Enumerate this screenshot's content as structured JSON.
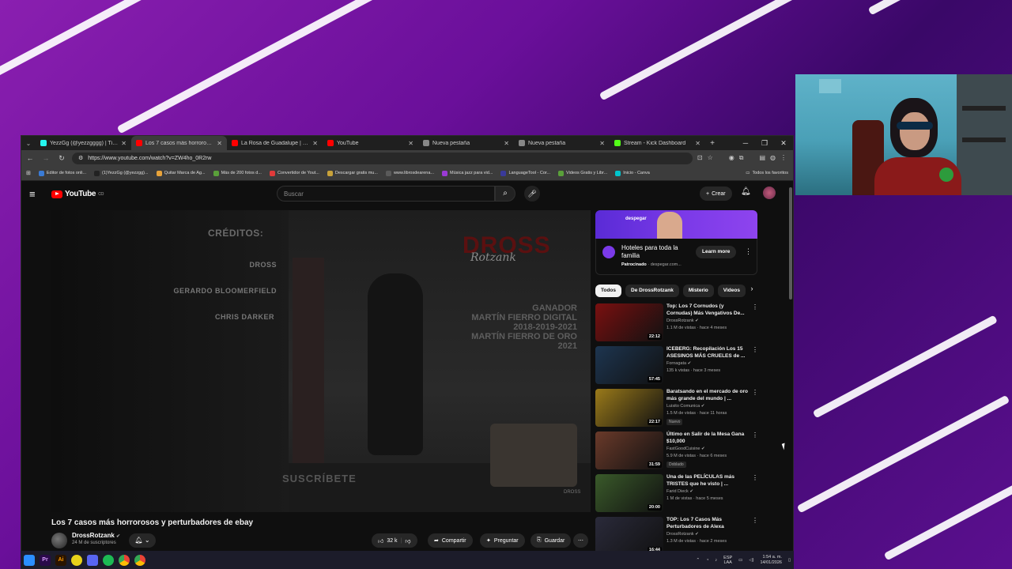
{
  "browser": {
    "tabs": [
      {
        "title": "YezzGg (@yezzgggg) | TikTok",
        "favicon_color": "#25f4ee"
      },
      {
        "title": "Los 7 casos más horrorosos y p",
        "favicon_color": "#ff0000"
      },
      {
        "title": "La Rosa de Guadalupe | El Nov",
        "favicon_color": "#ff0000"
      },
      {
        "title": "YouTube",
        "favicon_color": "#ff0000"
      },
      {
        "title": "Nueva pestaña",
        "favicon_color": "#888888"
      },
      {
        "title": "Nueva pestaña",
        "favicon_color": "#888888"
      },
      {
        "title": "Stream - Kick Dashboard",
        "favicon_color": "#53fc18"
      }
    ],
    "url": "https://www.youtube.com/watch?v=ZW4ho_0R2rw",
    "bookmarks": [
      "Editor de fotos onli...",
      "(1)YezzGg (@yezzgg)...",
      "Quitar Marca de Ag...",
      "Más de 200 fotos d...",
      "Convertidor de Yout...",
      "Descargar gratis mu...",
      "www.librosdearena...",
      "Música jazz para vid...",
      "LanguageTool - Cor...",
      "Videos Gratis y Libr...",
      "Inicio - Canva"
    ],
    "bookmarks_folder": "Todos los favoritos"
  },
  "youtube": {
    "logo_text": "YouTube",
    "logo_country": "CO",
    "search_placeholder": "Buscar",
    "create_label": "Crear",
    "video": {
      "credits_title": "CRÉDITOS:",
      "credits_lines": [
        "DROSS",
        "GERARDO BLOOMERFIELD",
        "CHRIS DARKER"
      ],
      "logo_text": "DROSS",
      "logo_sub": "Rotzank",
      "award_text": [
        "GANADOR",
        "MARTÍN FIERRO DIGITAL",
        "2018-2019-2021",
        "MARTÍN FIERRO DE ORO",
        "2021"
      ],
      "subscribe_text": "SUSCRÍBETE",
      "title": "Los 7 casos más horrorosos y perturbadores de ebay"
    },
    "channel": {
      "name": "DrossRotzank",
      "subscribers": "24 M de suscriptores"
    },
    "actions": {
      "likes": "32 k",
      "share": "Compartir",
      "ask": "Preguntar",
      "save": "Guardar"
    },
    "ad": {
      "brand": "despegar",
      "title": "Hoteles para toda la familia",
      "sponsored": "Patrocinado",
      "domain": "despegar.com...",
      "cta": "Learn more"
    },
    "chips": [
      "Todos",
      "De DrossRotzank",
      "Misterio",
      "Videos"
    ],
    "recommendations": [
      {
        "title": "Top: Los 7 Cornudos (y Cornudas) Más Vengativos De...",
        "channel": "DrossRotzank",
        "meta": "1.1 M de vistas · hace 4 meses",
        "duration": "22:12",
        "badge": "",
        "thumb": "#7a1010"
      },
      {
        "title": "ICEBERG: Recopilación Los 15 ASESINOS MÁS CRUELES de ...",
        "channel": "Fornagata",
        "meta": "135 k vistas · hace 3 meses",
        "duration": "57:45",
        "badge": "",
        "thumb": "#1d3550"
      },
      {
        "title": "Baratsando en el mercado de oro más grande del mundo | ...",
        "channel": "Luisito Comunica",
        "meta": "1.5 M de vistas · hace 11 horas",
        "duration": "22:17",
        "badge": "Nuevo",
        "thumb": "#9a7a1a"
      },
      {
        "title": "Último en Salir de la Mesa Gana $10,000",
        "channel": "FastGoodCuisine",
        "meta": "5.9 M de vistas · hace 6 meses",
        "duration": "31:59",
        "badge": "Doblado",
        "thumb": "#6a3a2a"
      },
      {
        "title": "Una de las PELÍCULAS más TRISTES que he visto | ...",
        "channel": "Farid Dieck",
        "meta": "1 M de vistas · hace 5 meses",
        "duration": "20:00",
        "badge": "",
        "thumb": "#3a5a2a"
      },
      {
        "title": "TOP: Los 7 Casos Más Perturbadores de Alexa",
        "channel": "DrossRotzank",
        "meta": "1.3 M de vistas · hace 2 meses",
        "duration": "16:44",
        "badge": "",
        "thumb": "#2a2a3a"
      }
    ]
  },
  "taskbar": {
    "lang": "ESP",
    "lang2": "LAA",
    "time": "1:54 a. m.",
    "date": "14/01/2026"
  }
}
